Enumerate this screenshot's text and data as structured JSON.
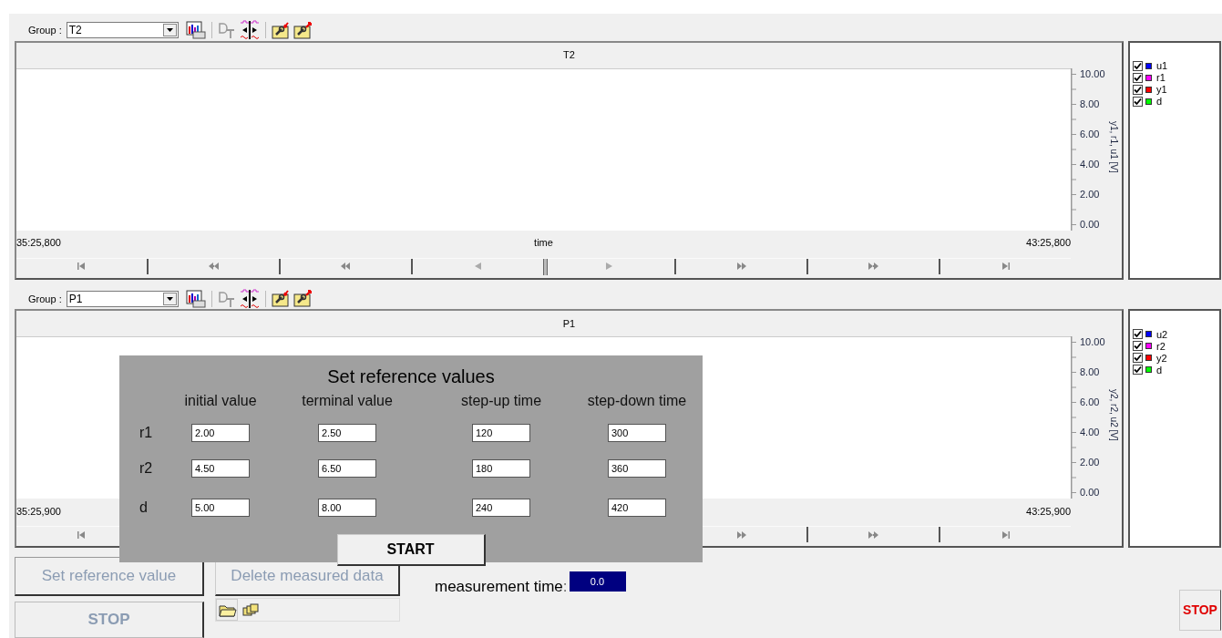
{
  "panels": [
    {
      "group_label": "Group :",
      "group_value": "T2",
      "title": "T2",
      "y_ticks": [
        "10.00",
        "8.00",
        "6.00",
        "4.00",
        "2.00",
        "0.00"
      ],
      "y_label": "y1, r1, u1 [V]",
      "x_start": "35:25,800",
      "x_label": "time",
      "x_end": "43:25,800",
      "nav_buttons": [
        {
          "kind": "first"
        },
        {
          "kind": "fast-back"
        },
        {
          "kind": "back"
        },
        {
          "kind": "prev"
        },
        {
          "kind": "thumb"
        },
        {
          "kind": "next"
        },
        {
          "kind": "forward"
        },
        {
          "kind": "fast-forward"
        },
        {
          "kind": "last"
        }
      ],
      "legend": [
        {
          "label": "u1",
          "checked": true,
          "color": "#0000ff"
        },
        {
          "label": "r1",
          "checked": true,
          "color": "#ff00ff"
        },
        {
          "label": "y1",
          "checked": true,
          "color": "#ff0000"
        },
        {
          "label": "d",
          "checked": true,
          "color": "#00ff00"
        }
      ]
    },
    {
      "group_label": "Group :",
      "group_value": "P1",
      "title": "P1",
      "y_ticks": [
        "10.00",
        "8.00",
        "6.00",
        "4.00",
        "2.00",
        "0.00"
      ],
      "y_label": "y2, r2, u2 [V]",
      "x_start": "35:25,900",
      "x_end": "43:25,900",
      "nav_buttons": [
        {
          "kind": "first"
        },
        {
          "kind": "forward"
        },
        {
          "kind": "fast-forward"
        },
        {
          "kind": "last"
        }
      ],
      "legend": [
        {
          "label": "u2",
          "checked": true,
          "color": "#0000ff"
        },
        {
          "label": "r2",
          "checked": true,
          "color": "#ff00ff"
        },
        {
          "label": "y2",
          "checked": true,
          "color": "#ff0000"
        },
        {
          "label": "d",
          "checked": true,
          "color": "#00ff00"
        }
      ]
    }
  ],
  "dialog": {
    "title": "Set reference values",
    "columns": [
      "initial value",
      "terminal value",
      "step-up time",
      "step-down time"
    ],
    "rows": [
      {
        "label": "r1",
        "values": [
          "2.00",
          "2.50",
          "120",
          "300"
        ]
      },
      {
        "label": "r2",
        "values": [
          "4.50",
          "6.50",
          "180",
          "360"
        ]
      },
      {
        "label": "d",
        "values": [
          "5.00",
          "8.00",
          "240",
          "420"
        ]
      }
    ],
    "start_button": "START"
  },
  "bottom": {
    "set_reference_button": {
      "label": "Set reference value",
      "disabled": true
    },
    "delete_button": {
      "label": "Delete measured data",
      "disabled": true
    },
    "stop_button": {
      "label": "STOP",
      "disabled": true
    },
    "measurement_label": "measurement time",
    "measurement_separator": ":",
    "measurement_value": "0.0",
    "emergency_stop": "STOP"
  }
}
